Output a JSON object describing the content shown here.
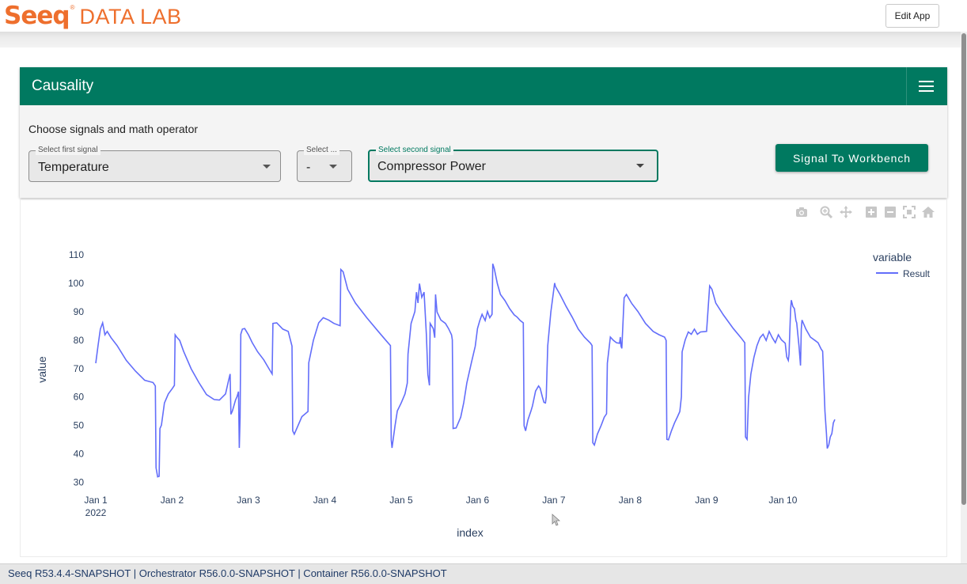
{
  "app": {
    "logo_text": "Seeq",
    "logo_suffix": "DATA LAB",
    "edit_button": "Edit App"
  },
  "card": {
    "title": "Causality",
    "instruction": "Choose signals and math operator",
    "first_signal": {
      "label": "Select first signal",
      "value": "Temperature"
    },
    "operator": {
      "label": "Select ...",
      "value": "-"
    },
    "second_signal": {
      "label": "Select second signal",
      "value": "Compressor Power"
    },
    "action_button": "Signal To Workbench"
  },
  "modebar": [
    "camera-icon",
    "zoom-icon",
    "pan-icon",
    "zoom-in-icon",
    "zoom-out-icon",
    "autoscale-icon",
    "reset-axes-icon"
  ],
  "chart_data": {
    "type": "line",
    "title": "",
    "xlabel": "index",
    "ylabel": "value",
    "legend_title": "variable",
    "legend_position": "top-right",
    "grid": false,
    "xlim": [
      0,
      9.97
    ],
    "ylim": [
      29,
      112
    ],
    "x_ticks": [
      {
        "x": 0,
        "label": "Jan 1",
        "sub": "2022"
      },
      {
        "x": 1,
        "label": "Jan 2",
        "sub": ""
      },
      {
        "x": 2,
        "label": "Jan 3",
        "sub": ""
      },
      {
        "x": 3,
        "label": "Jan 4",
        "sub": ""
      },
      {
        "x": 4,
        "label": "Jan 5",
        "sub": ""
      },
      {
        "x": 5,
        "label": "Jan 6",
        "sub": ""
      },
      {
        "x": 6,
        "label": "Jan 7",
        "sub": ""
      },
      {
        "x": 7,
        "label": "Jan 8",
        "sub": ""
      },
      {
        "x": 8,
        "label": "Jan 9",
        "sub": ""
      },
      {
        "x": 9,
        "label": "Jan 10",
        "sub": ""
      }
    ],
    "y_ticks": [
      30,
      40,
      50,
      60,
      70,
      80,
      90,
      100,
      110
    ],
    "series": [
      {
        "name": "Result",
        "color": "#636efa",
        "x_unit": "days since Jan 1 2022",
        "points": [
          [
            0.0,
            72
          ],
          [
            0.03,
            78
          ],
          [
            0.06,
            84
          ],
          [
            0.09,
            86
          ],
          [
            0.12,
            82
          ],
          [
            0.15,
            83
          ],
          [
            0.2,
            81
          ],
          [
            0.28,
            78
          ],
          [
            0.4,
            73
          ],
          [
            0.52,
            69
          ],
          [
            0.64,
            66
          ],
          [
            0.75,
            65
          ],
          [
            0.78,
            64
          ],
          [
            0.79,
            35
          ],
          [
            0.81,
            32
          ],
          [
            0.83,
            32
          ],
          [
            0.84,
            49
          ],
          [
            0.86,
            50
          ],
          [
            0.9,
            58
          ],
          [
            0.95,
            61
          ],
          [
            1.0,
            63
          ],
          [
            1.03,
            64
          ],
          [
            1.04,
            82
          ],
          [
            1.06,
            81
          ],
          [
            1.1,
            80
          ],
          [
            1.15,
            76
          ],
          [
            1.25,
            70
          ],
          [
            1.35,
            65
          ],
          [
            1.45,
            61
          ],
          [
            1.55,
            59
          ],
          [
            1.62,
            59
          ],
          [
            1.7,
            61
          ],
          [
            1.74,
            66
          ],
          [
            1.76,
            68
          ],
          [
            1.77,
            54
          ],
          [
            1.79,
            55
          ],
          [
            1.83,
            59
          ],
          [
            1.85,
            60
          ],
          [
            1.87,
            62
          ],
          [
            1.88,
            42
          ],
          [
            1.89,
            53
          ],
          [
            1.9,
            82
          ],
          [
            1.92,
            84
          ],
          [
            1.95,
            84
          ],
          [
            2.0,
            82
          ],
          [
            2.05,
            79
          ],
          [
            2.12,
            76
          ],
          [
            2.2,
            73
          ],
          [
            2.27,
            70
          ],
          [
            2.31,
            68
          ],
          [
            2.32,
            86
          ],
          [
            2.37,
            86
          ],
          [
            2.45,
            84
          ],
          [
            2.52,
            83
          ],
          [
            2.57,
            78
          ],
          [
            2.58,
            48
          ],
          [
            2.6,
            47
          ],
          [
            2.7,
            53
          ],
          [
            2.78,
            55
          ],
          [
            2.79,
            72
          ],
          [
            2.85,
            80
          ],
          [
            2.92,
            86
          ],
          [
            2.98,
            88
          ],
          [
            3.05,
            87
          ],
          [
            3.12,
            86
          ],
          [
            3.2,
            85
          ],
          [
            3.21,
            105
          ],
          [
            3.24,
            104
          ],
          [
            3.3,
            98
          ],
          [
            3.4,
            93
          ],
          [
            3.55,
            88
          ],
          [
            3.7,
            83
          ],
          [
            3.8,
            80
          ],
          [
            3.86,
            78
          ],
          [
            3.87,
            45
          ],
          [
            3.88,
            42
          ],
          [
            3.92,
            50
          ],
          [
            3.95,
            55
          ],
          [
            4.0,
            58
          ],
          [
            4.05,
            61
          ],
          [
            4.08,
            65
          ],
          [
            4.09,
            75
          ],
          [
            4.13,
            86
          ],
          [
            4.18,
            90
          ],
          [
            4.2,
            97
          ],
          [
            4.22,
            93
          ],
          [
            4.24,
            100
          ],
          [
            4.27,
            95
          ],
          [
            4.3,
            97
          ],
          [
            4.33,
            82
          ],
          [
            4.35,
            68
          ],
          [
            4.37,
            64
          ],
          [
            4.38,
            86
          ],
          [
            4.42,
            84
          ],
          [
            4.44,
            81
          ],
          [
            4.45,
            96
          ],
          [
            4.47,
            90
          ],
          [
            4.52,
            87
          ],
          [
            4.58,
            86
          ],
          [
            4.62,
            84
          ],
          [
            4.66,
            82
          ],
          [
            4.67,
            80
          ],
          [
            4.68,
            49
          ],
          [
            4.72,
            49
          ],
          [
            4.78,
            53
          ],
          [
            4.82,
            58
          ],
          [
            4.86,
            65
          ],
          [
            4.92,
            72
          ],
          [
            4.97,
            78
          ],
          [
            5.0,
            84
          ],
          [
            5.03,
            87
          ],
          [
            5.06,
            89
          ],
          [
            5.1,
            87
          ],
          [
            5.13,
            90
          ],
          [
            5.16,
            88
          ],
          [
            5.19,
            89
          ],
          [
            5.2,
            107
          ],
          [
            5.22,
            105
          ],
          [
            5.26,
            100
          ],
          [
            5.3,
            96
          ],
          [
            5.36,
            94
          ],
          [
            5.42,
            91
          ],
          [
            5.48,
            89
          ],
          [
            5.52,
            88
          ],
          [
            5.56,
            87
          ],
          [
            5.6,
            86
          ],
          [
            5.61,
            50
          ],
          [
            5.63,
            48
          ],
          [
            5.66,
            52
          ],
          [
            5.7,
            55
          ],
          [
            5.72,
            57
          ],
          [
            5.76,
            62
          ],
          [
            5.8,
            64
          ],
          [
            5.82,
            63
          ],
          [
            5.85,
            60
          ],
          [
            5.87,
            58
          ],
          [
            5.89,
            58
          ],
          [
            5.9,
            60
          ],
          [
            5.91,
            70
          ],
          [
            5.92,
            78
          ],
          [
            5.96,
            90
          ],
          [
            6.01,
            100
          ],
          [
            6.02,
            99
          ],
          [
            6.08,
            96
          ],
          [
            6.16,
            92
          ],
          [
            6.24,
            88
          ],
          [
            6.32,
            84
          ],
          [
            6.4,
            81
          ],
          [
            6.48,
            79
          ],
          [
            6.5,
            78
          ],
          [
            6.51,
            44
          ],
          [
            6.53,
            43
          ],
          [
            6.57,
            47
          ],
          [
            6.62,
            50
          ],
          [
            6.66,
            53
          ],
          [
            6.69,
            54
          ],
          [
            6.7,
            72
          ],
          [
            6.74,
            81
          ],
          [
            6.78,
            80
          ],
          [
            6.82,
            79
          ],
          [
            6.86,
            79
          ],
          [
            6.87,
            81
          ],
          [
            6.88,
            78
          ],
          [
            6.89,
            77
          ],
          [
            6.92,
            95
          ],
          [
            6.95,
            96
          ],
          [
            7.02,
            93
          ],
          [
            7.1,
            90
          ],
          [
            7.2,
            86
          ],
          [
            7.3,
            83
          ],
          [
            7.38,
            82
          ],
          [
            7.45,
            81
          ],
          [
            7.47,
            80
          ],
          [
            7.48,
            45
          ],
          [
            7.5,
            45
          ],
          [
            7.54,
            48
          ],
          [
            7.58,
            51
          ],
          [
            7.62,
            53
          ],
          [
            7.65,
            55
          ],
          [
            7.67,
            60
          ],
          [
            7.68,
            76
          ],
          [
            7.72,
            80
          ],
          [
            7.76,
            83
          ],
          [
            7.8,
            82
          ],
          [
            7.84,
            84
          ],
          [
            7.88,
            82
          ],
          [
            7.92,
            83
          ],
          [
            8.0,
            83
          ],
          [
            8.02,
            91
          ],
          [
            8.04,
            99
          ],
          [
            8.07,
            98
          ],
          [
            8.12,
            93
          ],
          [
            8.22,
            89
          ],
          [
            8.35,
            84
          ],
          [
            8.45,
            81
          ],
          [
            8.5,
            79
          ],
          [
            8.51,
            46
          ],
          [
            8.53,
            45
          ],
          [
            8.55,
            60
          ],
          [
            8.58,
            68
          ],
          [
            8.62,
            74
          ],
          [
            8.66,
            78
          ],
          [
            8.7,
            81
          ],
          [
            8.74,
            82
          ],
          [
            8.78,
            80
          ],
          [
            8.82,
            83
          ],
          [
            8.86,
            81
          ],
          [
            8.9,
            79
          ],
          [
            8.94,
            82
          ],
          [
            8.98,
            80
          ],
          [
            9.03,
            79
          ],
          [
            9.05,
            74
          ],
          [
            9.07,
            73
          ],
          [
            9.08,
            75
          ],
          [
            9.1,
            91
          ],
          [
            9.11,
            94
          ],
          [
            9.13,
            92
          ],
          [
            9.15,
            91
          ],
          [
            9.17,
            87
          ],
          [
            9.18,
            86
          ],
          [
            9.21,
            78
          ],
          [
            9.23,
            71
          ],
          [
            9.24,
            84
          ],
          [
            9.25,
            87
          ],
          [
            9.3,
            84
          ],
          [
            9.36,
            81
          ],
          [
            9.42,
            80
          ],
          [
            9.46,
            79
          ],
          [
            9.5,
            77
          ],
          [
            9.52,
            76
          ],
          [
            9.55,
            55
          ],
          [
            9.57,
            47
          ],
          [
            9.58,
            42
          ],
          [
            9.6,
            43
          ],
          [
            9.62,
            46
          ],
          [
            9.64,
            47
          ],
          [
            9.66,
            51
          ],
          [
            9.68,
            52
          ]
        ]
      }
    ]
  },
  "footer": {
    "version_text": "Seeq R53.4.4-SNAPSHOT | Orchestrator R56.0.0-SNAPSHOT | Container R56.0.0-SNAPSHOT"
  }
}
